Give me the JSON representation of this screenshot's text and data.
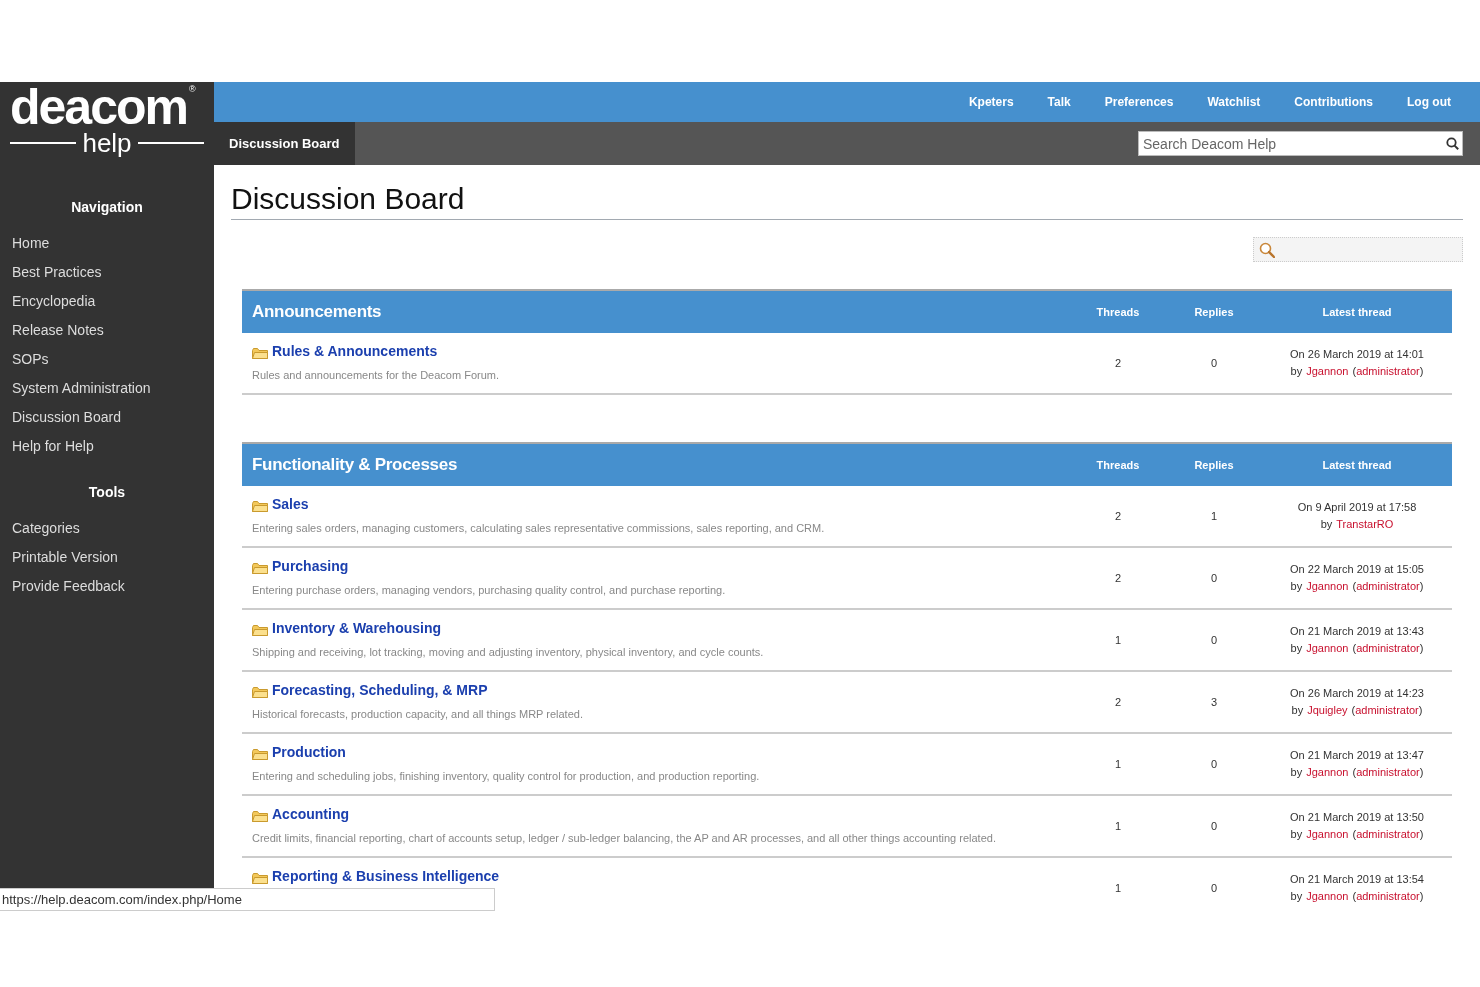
{
  "logo": {
    "wordmark": "deacom",
    "mark": "®",
    "tagline": "help"
  },
  "user_menu": [
    "Kpeters",
    "Talk",
    "Preferences",
    "Watchlist",
    "Contributions",
    "Log out"
  ],
  "tabs": [
    {
      "label": "Discussion Board",
      "selected": true
    }
  ],
  "search": {
    "placeholder": "Search Deacom Help"
  },
  "sidebar": [
    {
      "heading": "Navigation",
      "items": [
        "Home",
        "Best Practices",
        "Encyclopedia",
        "Release Notes",
        "SOPs",
        "System Administration",
        "Discussion Board",
        "Help for Help"
      ]
    },
    {
      "heading": "Tools",
      "items": [
        "Categories",
        "Printable Version",
        "Provide Feedback"
      ]
    }
  ],
  "page_title": "Discussion Board",
  "categories": [
    {
      "title": "Announcements",
      "columns": [
        "Threads",
        "Replies",
        "Latest thread"
      ],
      "forums": [
        {
          "name": "Rules & Announcements",
          "description": "Rules and announcements for the Deacom Forum.",
          "threads": "2",
          "replies": "0",
          "latest": {
            "date": "On 26 March 2019 at 14:01",
            "by": "by",
            "user": "Jgannon",
            "role_open": "(",
            "role": "administrator",
            "role_close": ")"
          }
        }
      ]
    },
    {
      "title": "Functionality & Processes",
      "columns": [
        "Threads",
        "Replies",
        "Latest thread"
      ],
      "forums": [
        {
          "name": "Sales",
          "description": "Entering sales orders, managing customers, calculating sales representative commissions, sales reporting, and CRM.",
          "threads": "2",
          "replies": "1",
          "latest": {
            "date": "On 9 April 2019 at 17:58",
            "by": "by",
            "user": "TranstarRO"
          }
        },
        {
          "name": "Purchasing",
          "description": "Entering purchase orders, managing vendors, purchasing quality control, and purchase reporting.",
          "threads": "2",
          "replies": "0",
          "latest": {
            "date": "On 22 March 2019 at 15:05",
            "by": "by",
            "user": "Jgannon",
            "role_open": "(",
            "role": "administrator",
            "role_close": ")"
          }
        },
        {
          "name": "Inventory & Warehousing",
          "description": "Shipping and receiving, lot tracking, moving and adjusting inventory, physical inventory, and cycle counts.",
          "threads": "1",
          "replies": "0",
          "latest": {
            "date": "On 21 March 2019 at 13:43",
            "by": "by",
            "user": "Jgannon",
            "role_open": "(",
            "role": "administrator",
            "role_close": ")"
          }
        },
        {
          "name": "Forecasting, Scheduling, & MRP",
          "description": "Historical forecasts, production capacity, and all things MRP related.",
          "threads": "2",
          "replies": "3",
          "latest": {
            "date": "On 26 March 2019 at 14:23",
            "by": "by",
            "user": "Jquigley",
            "role_open": "(",
            "role": "administrator",
            "role_close": ")"
          }
        },
        {
          "name": "Production",
          "description": "Entering and scheduling jobs, finishing inventory, quality control for production, and production reporting.",
          "threads": "1",
          "replies": "0",
          "latest": {
            "date": "On 21 March 2019 at 13:47",
            "by": "by",
            "user": "Jgannon",
            "role_open": "(",
            "role": "administrator",
            "role_close": ")"
          }
        },
        {
          "name": "Accounting",
          "description": "Credit limits, financial reporting, chart of accounts setup, ledger / sub-ledger balancing, the AP and AR processes, and all other things accounting related.",
          "threads": "1",
          "replies": "0",
          "latest": {
            "date": "On 21 March 2019 at 13:50",
            "by": "by",
            "user": "Jgannon",
            "role_open": "(",
            "role": "administrator",
            "role_close": ")"
          }
        },
        {
          "name": "Reporting & Business Intelligence",
          "threads": "1",
          "replies": "0",
          "latest": {
            "date": "On 21 March 2019 at 13:54",
            "by": "by",
            "user": "Jgannon",
            "role_open": "(",
            "role": "administrator",
            "role_close": ")"
          }
        }
      ]
    }
  ],
  "status_url": "https://help.deacom.com/index.php/Home"
}
